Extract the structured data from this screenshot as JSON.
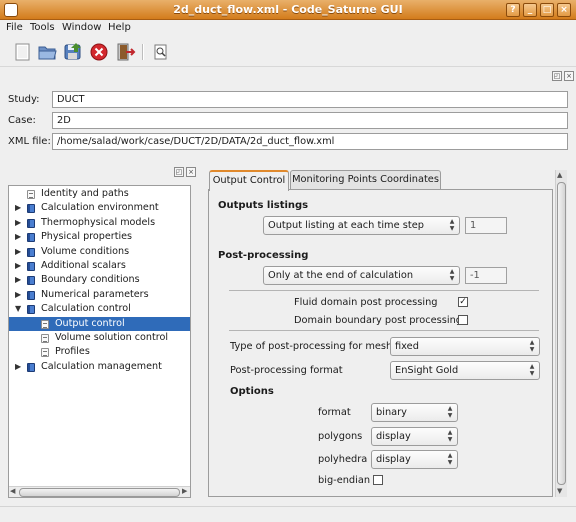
{
  "window": {
    "title": "2d_duct_flow.xml - Code_Saturne GUI",
    "controls": {
      "help": "?",
      "minimize": "_",
      "maximize": "□",
      "close": "×"
    }
  },
  "menubar": {
    "items": [
      {
        "label": "File"
      },
      {
        "label": "Tools"
      },
      {
        "label": "Window"
      },
      {
        "label": "Help"
      }
    ]
  },
  "toolbar": {
    "icons": [
      "new-file-icon",
      "open-folder-icon",
      "save-icon",
      "close-case-icon",
      "quit-icon",
      "identity-icon"
    ]
  },
  "case_info": {
    "study_label": "Study:",
    "study_value": "DUCT",
    "case_label": "Case:",
    "case_value": "2D",
    "xml_label": "XML file:",
    "xml_value": "/home/salad/work/case/DUCT/2D/DATA/2d_duct_flow.xml"
  },
  "tree": {
    "items": [
      {
        "label": "Identity and paths",
        "level": 0,
        "expandable": false,
        "icon": "page-icon"
      },
      {
        "label": "Calculation environment",
        "level": 0,
        "expandable": true,
        "icon": "book-icon"
      },
      {
        "label": "Thermophysical models",
        "level": 0,
        "expandable": true,
        "icon": "book-icon"
      },
      {
        "label": "Physical properties",
        "level": 0,
        "expandable": true,
        "icon": "book-icon"
      },
      {
        "label": "Volume conditions",
        "level": 0,
        "expandable": true,
        "icon": "book-icon"
      },
      {
        "label": "Additional scalars",
        "level": 0,
        "expandable": true,
        "icon": "book-icon"
      },
      {
        "label": "Boundary conditions",
        "level": 0,
        "expandable": true,
        "icon": "book-icon"
      },
      {
        "label": "Numerical parameters",
        "level": 0,
        "expandable": true,
        "icon": "book-icon"
      },
      {
        "label": "Calculation control",
        "level": 0,
        "expandable": true,
        "expanded": true,
        "icon": "book-icon"
      },
      {
        "label": "Output control",
        "level": 1,
        "expandable": false,
        "selected": true,
        "icon": "page-icon"
      },
      {
        "label": "Volume solution control",
        "level": 1,
        "expandable": false,
        "icon": "page-icon"
      },
      {
        "label": "Profiles",
        "level": 1,
        "expandable": false,
        "icon": "page-icon"
      },
      {
        "label": "Calculation management",
        "level": 0,
        "expandable": true,
        "icon": "book-icon"
      }
    ]
  },
  "tabs": [
    {
      "label": "Output Control",
      "active": true
    },
    {
      "label": "Monitoring Points Coordinates",
      "active": false
    }
  ],
  "output_control": {
    "outputs_listings_title": "Outputs listings",
    "listing_option": "Output listing at each time step",
    "listing_value": "1",
    "post_processing_title": "Post-processing",
    "post_option": "Only at the end of calculation",
    "post_value": "-1",
    "fluid_domain_label": "Fluid domain post processing",
    "fluid_domain_checked": "✓",
    "boundary_domain_label": "Domain boundary post processing",
    "boundary_domain_checked": "",
    "mesh_type_label": "Type of post-processing for mesh",
    "mesh_type_value": "fixed",
    "format_label": "Post-processing format",
    "format_value": "EnSight Gold",
    "options_title": "Options",
    "format_option_label": "format",
    "format_option_value": "binary",
    "polygons_label": "polygons",
    "polygons_value": "display",
    "polyhedra_label": "polyhedra",
    "polyhedra_value": "display",
    "big_endian_label": "big-endian",
    "big_endian_checked": ""
  },
  "colors": {
    "titlebar": "#d37c1c",
    "selection": "#2f6bb9",
    "active_tab_accent": "#e0892c"
  }
}
